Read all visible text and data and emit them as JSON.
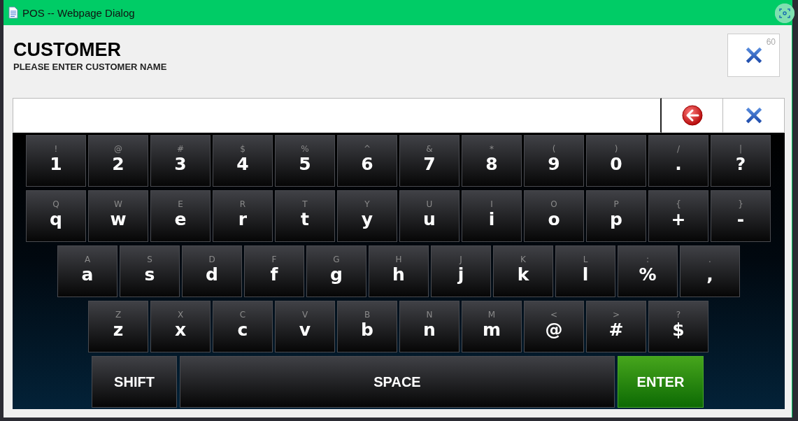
{
  "window": {
    "title": "POS -- Webpage Dialog"
  },
  "header": {
    "title": "CUSTOMER",
    "subtitle": "PLEASE ENTER CUSTOMER NAME",
    "close_button": {
      "countdown": "60"
    }
  },
  "keyboard": {
    "rows": [
      {
        "keys": [
          {
            "kind": "char",
            "upper": "!",
            "label": "1"
          },
          {
            "kind": "char",
            "upper": "@",
            "label": "2"
          },
          {
            "kind": "char",
            "upper": "#",
            "label": "3"
          },
          {
            "kind": "char",
            "upper": "$",
            "label": "4"
          },
          {
            "kind": "char",
            "upper": "%",
            "label": "5"
          },
          {
            "kind": "char",
            "upper": "^",
            "label": "6"
          },
          {
            "kind": "char",
            "upper": "&",
            "label": "7"
          },
          {
            "kind": "char",
            "upper": "*",
            "label": "8"
          },
          {
            "kind": "char",
            "upper": "(",
            "label": "9"
          },
          {
            "kind": "char",
            "upper": ")",
            "label": "0"
          },
          {
            "kind": "char",
            "upper": "/",
            "label": "."
          },
          {
            "kind": "char",
            "upper": "|",
            "label": "?"
          }
        ]
      },
      {
        "keys": [
          {
            "kind": "char",
            "upper": "Q",
            "label": "q"
          },
          {
            "kind": "char",
            "upper": "W",
            "label": "w"
          },
          {
            "kind": "char",
            "upper": "E",
            "label": "e"
          },
          {
            "kind": "char",
            "upper": "R",
            "label": "r"
          },
          {
            "kind": "char",
            "upper": "T",
            "label": "t"
          },
          {
            "kind": "char",
            "upper": "Y",
            "label": "y"
          },
          {
            "kind": "char",
            "upper": "U",
            "label": "u"
          },
          {
            "kind": "char",
            "upper": "I",
            "label": "i"
          },
          {
            "kind": "char",
            "upper": "O",
            "label": "o"
          },
          {
            "kind": "char",
            "upper": "P",
            "label": "p"
          },
          {
            "kind": "char",
            "upper": "{",
            "label": "+"
          },
          {
            "kind": "char",
            "upper": "}",
            "label": "-"
          }
        ]
      },
      {
        "keys": [
          {
            "kind": "char",
            "upper": "A",
            "label": "a"
          },
          {
            "kind": "char",
            "upper": "S",
            "label": "s"
          },
          {
            "kind": "char",
            "upper": "D",
            "label": "d"
          },
          {
            "kind": "char",
            "upper": "F",
            "label": "f"
          },
          {
            "kind": "char",
            "upper": "G",
            "label": "g"
          },
          {
            "kind": "char",
            "upper": "H",
            "label": "h"
          },
          {
            "kind": "char",
            "upper": "J",
            "label": "j"
          },
          {
            "kind": "char",
            "upper": "K",
            "label": "k"
          },
          {
            "kind": "char",
            "upper": "L",
            "label": "l"
          },
          {
            "kind": "char",
            "upper": ":",
            "label": "%"
          },
          {
            "kind": "char",
            "upper": ".",
            "label": ","
          }
        ]
      },
      {
        "keys": [
          {
            "kind": "char",
            "upper": "Z",
            "label": "z"
          },
          {
            "kind": "char",
            "upper": "X",
            "label": "x"
          },
          {
            "kind": "char",
            "upper": "C",
            "label": "c"
          },
          {
            "kind": "char",
            "upper": "V",
            "label": "v"
          },
          {
            "kind": "char",
            "upper": "B",
            "label": "b"
          },
          {
            "kind": "char",
            "upper": "N",
            "label": "n"
          },
          {
            "kind": "char",
            "upper": "M",
            "label": "m"
          },
          {
            "kind": "char",
            "upper": "<",
            "label": "@"
          },
          {
            "kind": "char",
            "upper": ">",
            "label": "#"
          },
          {
            "kind": "char",
            "upper": "?",
            "label": "$"
          }
        ]
      },
      {
        "keys": [
          {
            "kind": "shift",
            "label": "SHIFT"
          },
          {
            "kind": "space",
            "label": "SPACE"
          },
          {
            "kind": "enter",
            "label": "ENTER"
          }
        ]
      }
    ]
  }
}
